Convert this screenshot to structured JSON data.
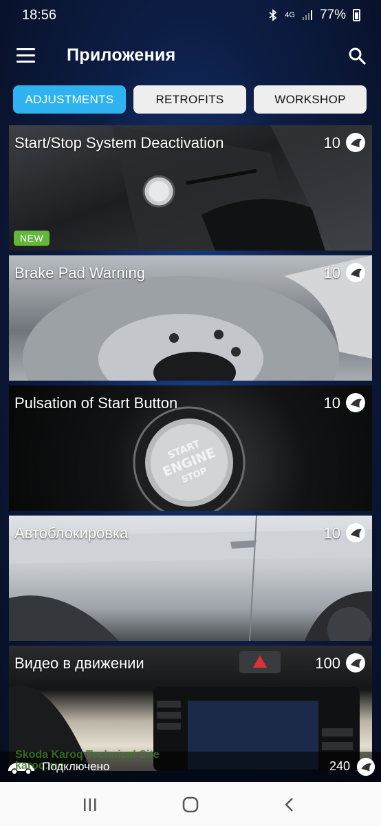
{
  "status_bar": {
    "time": "18:56",
    "network": "4G",
    "battery": "77%",
    "icons": [
      "bluetooth-icon",
      "signal-icon",
      "battery-icon"
    ]
  },
  "app_bar": {
    "title": "Приложения",
    "menu_icon": "hamburger-menu-icon",
    "search_icon": "search-icon"
  },
  "tabs": [
    {
      "label": "ADJUSTMENTS",
      "active": true
    },
    {
      "label": "RETROFITS",
      "active": false
    },
    {
      "label": "WORKSHOP",
      "active": false
    }
  ],
  "cards": [
    {
      "title": "Start/Stop System Deactivation",
      "count": "10",
      "badge": "NEW"
    },
    {
      "title": "Brake Pad Warning",
      "count": "10"
    },
    {
      "title": "Pulsation of Start Button",
      "count": "10"
    },
    {
      "title": "Автоблокировка",
      "count": "10"
    },
    {
      "title": "Видео в движении",
      "count": "100"
    }
  ],
  "bottom_bar": {
    "status": "Подключено",
    "watermark": "Skoda Karoq Technical Site",
    "watermark_sub": "karoq.me",
    "balance": "240"
  },
  "colors": {
    "accent": "#2eb3f0",
    "badge_new": "#63b53b",
    "background": "#0c1d44"
  }
}
